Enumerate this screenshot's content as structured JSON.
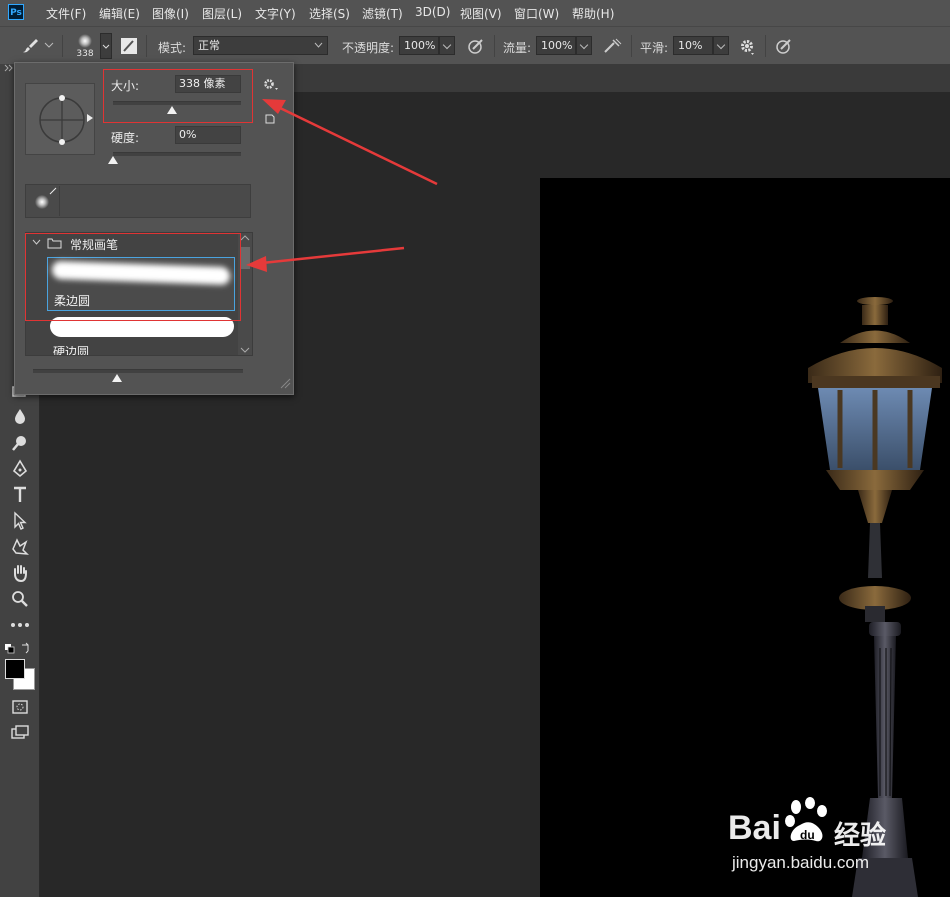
{
  "app": {
    "logo_text": "Ps"
  },
  "menu": [
    "文件(F)",
    "编辑(E)",
    "图像(I)",
    "图层(L)",
    "文字(Y)",
    "选择(S)",
    "滤镜(T)",
    "3D(D)",
    "视图(V)",
    "窗口(W)",
    "帮助(H)"
  ],
  "options_bar": {
    "brush_size_badge": "338",
    "mode_label": "模式:",
    "mode_value": "正常",
    "opacity_label": "不透明度:",
    "opacity_value": "100%",
    "flow_label": "流量:",
    "flow_value": "100%",
    "smoothing_label": "平滑:",
    "smoothing_value": "10%"
  },
  "brush_popup": {
    "size_label": "大小:",
    "size_value": "338 像素",
    "size_level": 0.46,
    "hardness_label": "硬度:",
    "hardness_value": "0%",
    "hardness_level": 0.0,
    "group_name": "常规画笔",
    "brushes": [
      {
        "name": "柔边圆",
        "selected": true
      },
      {
        "name": "硬边圆",
        "selected": false
      }
    ],
    "preview_size_level": 0.4
  },
  "colors": {
    "menu_bg": "#535353",
    "panel_bg": "#535353",
    "workspace_bg": "#282828",
    "highlight_box": "#e03434",
    "selected_outline": "#4aa3df",
    "canvas_bg": "#000000"
  },
  "watermark": {
    "brand": "Bai",
    "brand_suffix": "经验",
    "url": "jingyan.baidu.com"
  }
}
